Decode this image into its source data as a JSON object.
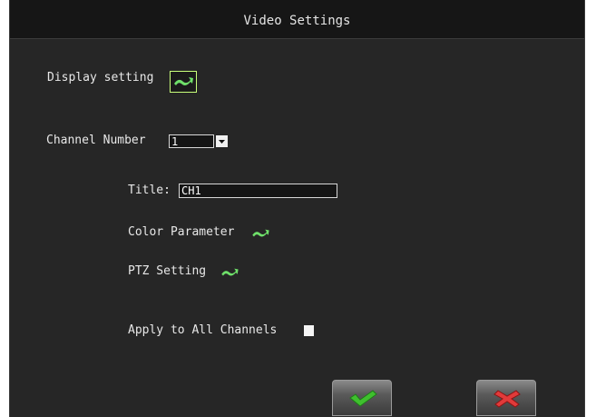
{
  "window": {
    "title": "Video Settings"
  },
  "display_setting": {
    "label": "Display setting",
    "button_icon": "green-arrow-icon"
  },
  "channel": {
    "label": "Channel Number",
    "value": "1",
    "dropdown_icon": "dropdown-arrow-icon"
  },
  "title_field": {
    "label": "Title:",
    "value": "CH1"
  },
  "color_parameter": {
    "label": "Color Parameter",
    "button_icon": "green-arrow-icon"
  },
  "ptz_setting": {
    "label": "PTZ Setting",
    "button_icon": "green-arrow-icon"
  },
  "apply_all": {
    "label": "Apply to All Channels",
    "checked": false
  },
  "actions": {
    "confirm_icon": "green-check-icon",
    "cancel_icon": "red-x-icon"
  },
  "colors": {
    "accent_green": "#6fe06a",
    "cancel_red": "#e23a3a",
    "background": "#262626"
  }
}
